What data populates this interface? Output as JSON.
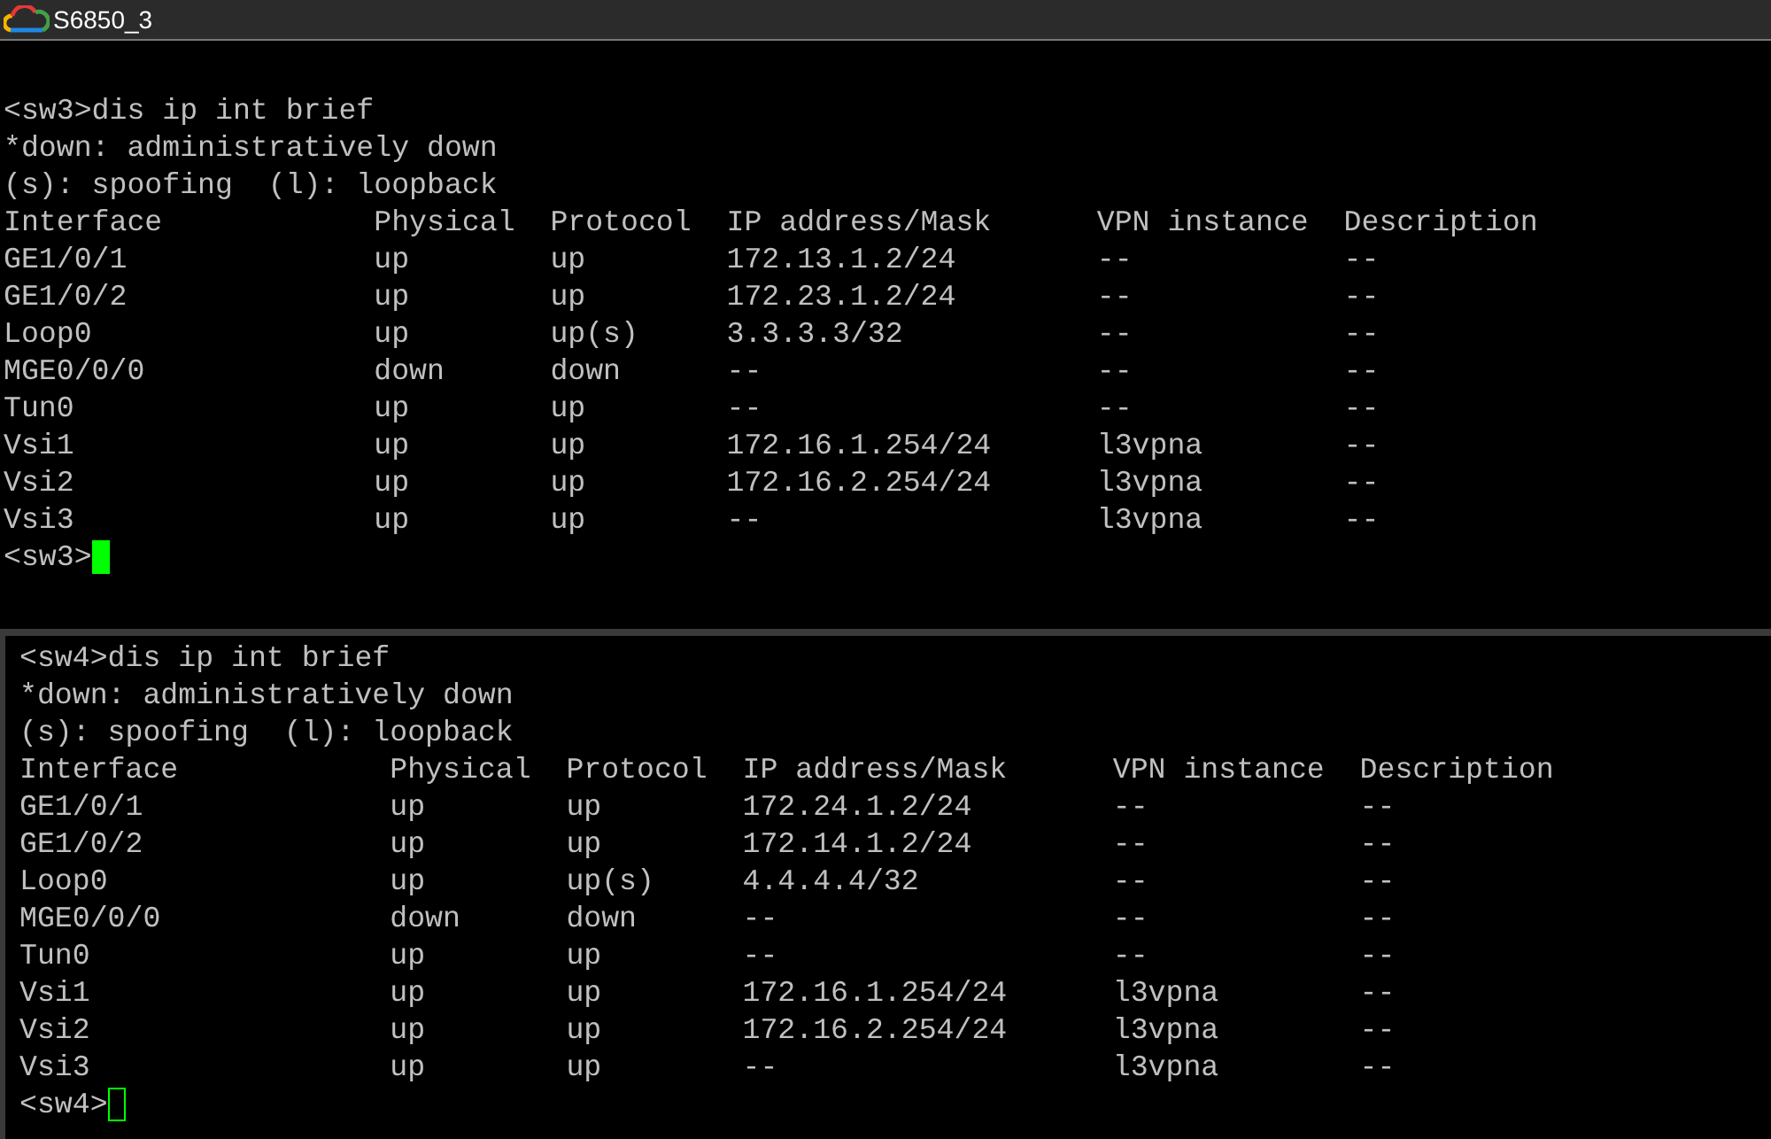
{
  "window": {
    "title": "S6850_3"
  },
  "panes": [
    {
      "focused": true,
      "lines": [
        "<sw3>dis ip int brief",
        "*down: administratively down",
        "(s): spoofing  (l): loopback"
      ],
      "columns": [
        "Interface",
        "Physical",
        "Protocol",
        "IP address/Mask",
        "VPN instance",
        "Description"
      ],
      "rows": [
        [
          "GE1/0/1",
          "up",
          "up",
          "172.13.1.2/24",
          "--",
          "--"
        ],
        [
          "GE1/0/2",
          "up",
          "up",
          "172.23.1.2/24",
          "--",
          "--"
        ],
        [
          "Loop0",
          "up",
          "up(s)",
          "3.3.3.3/32",
          "--",
          "--"
        ],
        [
          "MGE0/0/0",
          "down",
          "down",
          "--",
          "--",
          "--"
        ],
        [
          "Tun0",
          "up",
          "up",
          "--",
          "--",
          "--"
        ],
        [
          "Vsi1",
          "up",
          "up",
          "172.16.1.254/24",
          "l3vpna",
          "--"
        ],
        [
          "Vsi2",
          "up",
          "up",
          "172.16.2.254/24",
          "l3vpna",
          "--"
        ],
        [
          "Vsi3",
          "up",
          "up",
          "--",
          "l3vpna",
          "--"
        ]
      ],
      "prompt": "<sw3>"
    },
    {
      "focused": false,
      "lines": [
        "<sw4>dis ip int brief",
        "*down: administratively down",
        "(s): spoofing  (l): loopback"
      ],
      "columns": [
        "Interface",
        "Physical",
        "Protocol",
        "IP address/Mask",
        "VPN instance",
        "Description"
      ],
      "rows": [
        [
          "GE1/0/1",
          "up",
          "up",
          "172.24.1.2/24",
          "--",
          "--"
        ],
        [
          "GE1/0/2",
          "up",
          "up",
          "172.14.1.2/24",
          "--",
          "--"
        ],
        [
          "Loop0",
          "up",
          "up(s)",
          "4.4.4.4/32",
          "--",
          "--"
        ],
        [
          "MGE0/0/0",
          "down",
          "down",
          "--",
          "--",
          "--"
        ],
        [
          "Tun0",
          "up",
          "up",
          "--",
          "--",
          "--"
        ],
        [
          "Vsi1",
          "up",
          "up",
          "172.16.1.254/24",
          "l3vpna",
          "--"
        ],
        [
          "Vsi2",
          "up",
          "up",
          "172.16.2.254/24",
          "l3vpna",
          "--"
        ],
        [
          "Vsi3",
          "up",
          "up",
          "--",
          "l3vpna",
          "--"
        ]
      ],
      "prompt": "<sw4>"
    }
  ]
}
